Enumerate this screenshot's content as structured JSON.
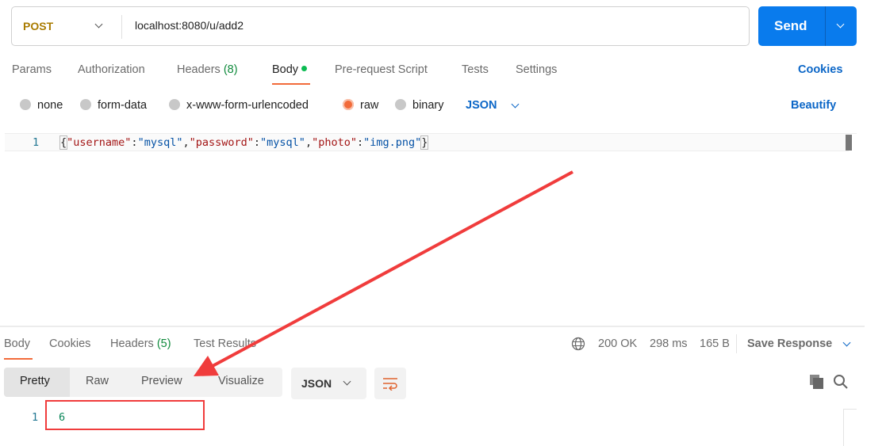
{
  "request": {
    "method": "POST",
    "url": "localhost:8080/u/add2",
    "send_label": "Send"
  },
  "req_tabs": {
    "params": "Params",
    "authorization": "Authorization",
    "headers": "Headers",
    "headers_count": "(8)",
    "body": "Body",
    "prerequest": "Pre-request Script",
    "tests": "Tests",
    "settings": "Settings",
    "cookies": "Cookies"
  },
  "body_types": {
    "none": "none",
    "form_data": "form-data",
    "urlencoded": "x-www-form-urlencoded",
    "raw": "raw",
    "binary": "binary",
    "format": "JSON",
    "beautify": "Beautify"
  },
  "editor": {
    "line_number": "1",
    "brace_open": "{",
    "k1": "\"username\"",
    "v1": "\"mysql\"",
    "k2": "\"password\"",
    "v2": "\"mysql\"",
    "k3": "\"photo\"",
    "v3": "\"img.png\"",
    "brace_close": "}"
  },
  "response": {
    "tabs": {
      "body": "Body",
      "cookies": "Cookies",
      "headers": "Headers",
      "headers_count": "(5)",
      "test_results": "Test Results"
    },
    "status": "200 OK",
    "time": "298 ms",
    "size": "165 B",
    "save_label": "Save Response",
    "views": {
      "pretty": "Pretty",
      "raw": "Raw",
      "preview": "Preview",
      "visualize": "Visualize"
    },
    "format": "JSON",
    "line_number": "1",
    "value": "6"
  },
  "colors": {
    "accent": "#f26b3a",
    "send": "#097bed",
    "annotation": "#f03c3c",
    "status": "#0f8a3c"
  }
}
